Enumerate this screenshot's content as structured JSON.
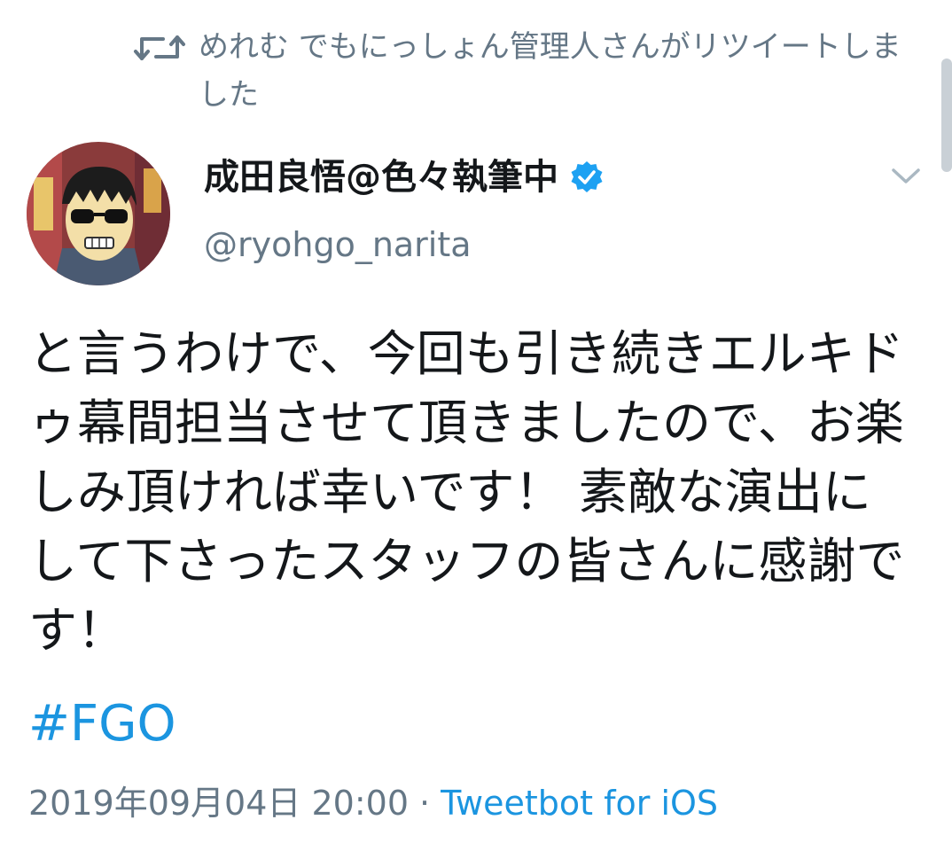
{
  "retweet": {
    "icon": "retweet-icon",
    "text": "めれむ でもにっしょん管理人さんがリツイートしました"
  },
  "author": {
    "display_name": "成田良悟@色々執筆中",
    "handle": "@ryohgo_narita",
    "verified": true,
    "verified_icon": "verified-badge-icon"
  },
  "tweet": {
    "text": "と言うわけで、今回も引き続きエルキドゥ幕間担当させて頂きましたので、お楽しみ頂ければ幸いです！ 素敵な演出にして下さったスタッフの皆さんに感謝です！",
    "hashtag": "#FGO"
  },
  "meta": {
    "timestamp": "2019年09月04日 20:00",
    "separator": "·",
    "client": "Tweetbot for iOS"
  },
  "colors": {
    "link": "#1b95e0",
    "secondary_text": "#657786",
    "primary_text": "#14171a",
    "verified": "#1da1f2"
  }
}
